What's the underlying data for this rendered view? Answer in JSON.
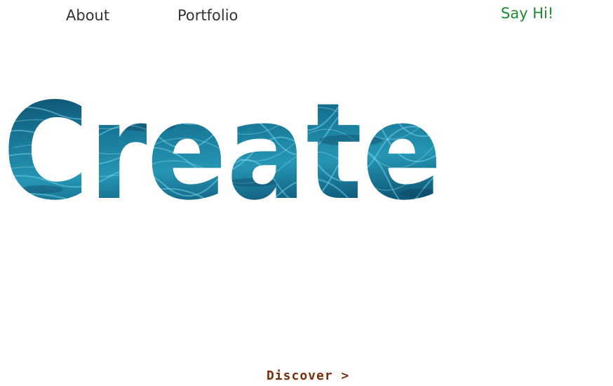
{
  "nav": {
    "about_label": "About",
    "portfolio_label": "Portfolio",
    "say_hi_label": "Say Hi!"
  },
  "hero": {
    "headline": "Create",
    "texture": "water-texture"
  },
  "cta": {
    "discover_label": "Discover >"
  },
  "colors": {
    "nav_text": "#333333",
    "say_hi": "#1e8a2e",
    "discover": "#7a2e0c",
    "water_dark": "#0c4a68",
    "water_mid": "#1a7d9c",
    "water_light": "#5cc4dc"
  }
}
